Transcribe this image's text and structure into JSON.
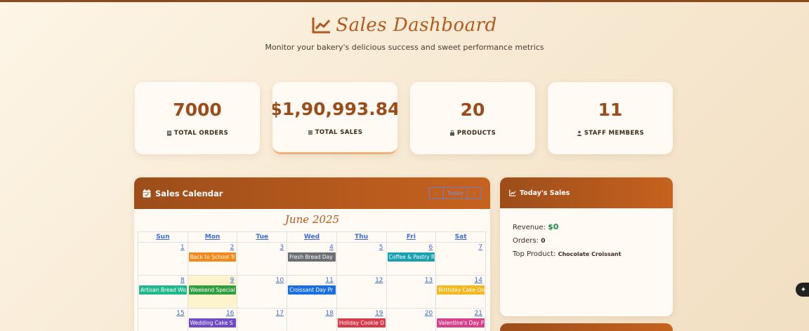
{
  "header": {
    "title": "Sales Dashboard",
    "subtitle": "Monitor your bakery's delicious success and sweet performance metrics"
  },
  "stats": [
    {
      "value": "7000",
      "label": "TOTAL ORDERS",
      "icon": "receipt-icon"
    },
    {
      "value": "$1,90,993.84",
      "label": "TOTAL SALES",
      "icon": "coins-icon"
    },
    {
      "value": "20",
      "label": "PRODUCTS",
      "icon": "box-icon"
    },
    {
      "value": "11",
      "label": "STAFF MEMBERS",
      "icon": "user-icon"
    }
  ],
  "calendar": {
    "title": "Sales Calendar",
    "today_label": "Today",
    "prev_label": "‹",
    "next_label": "›",
    "month": "June 2025",
    "weekdays": [
      "Sun",
      "Mon",
      "Tue",
      "Wed",
      "Thu",
      "Fri",
      "Sat"
    ],
    "weeks": [
      [
        {
          "day": "1"
        },
        {
          "day": "2",
          "event": "Back to School Tr",
          "color": "#f08a1c"
        },
        {
          "day": "3"
        },
        {
          "day": "4",
          "event": "Fresh Bread Day",
          "color": "#6b6e73"
        },
        {
          "day": "5"
        },
        {
          "day": "6",
          "event": "Coffee & Pastry R",
          "color": "#1aa0b0"
        },
        {
          "day": "7"
        }
      ],
      [
        {
          "day": "8",
          "event": "Artisan Bread Wo",
          "color": "#1fb88a"
        },
        {
          "day": "9",
          "event": "Weekend Special",
          "color": "#2e9e3e",
          "today": true
        },
        {
          "day": "10"
        },
        {
          "day": "11",
          "event": "Croissant Day Pr",
          "color": "#1a6fe0"
        },
        {
          "day": "12"
        },
        {
          "day": "13"
        },
        {
          "day": "14",
          "event": "Birthday Cake On",
          "color": "#f2b81c"
        }
      ],
      [
        {
          "day": "15"
        },
        {
          "day": "16",
          "event": "Wedding Cake S",
          "color": "#6f4bc4"
        },
        {
          "day": "17"
        },
        {
          "day": "18"
        },
        {
          "day": "19",
          "event": "Holiday Cookie D",
          "color": "#d93a4a"
        },
        {
          "day": "20"
        },
        {
          "day": "21",
          "event": "Valentine's Day P",
          "color": "#d6408a"
        }
      ]
    ]
  },
  "today_sales": {
    "title": "Today's Sales",
    "revenue_label": "Revenue:",
    "revenue_value": "$0",
    "orders_label": "Orders:",
    "orders_value": "0",
    "top_product_label": "Top Product:",
    "top_product_value": "Chocolate Croissant"
  }
}
